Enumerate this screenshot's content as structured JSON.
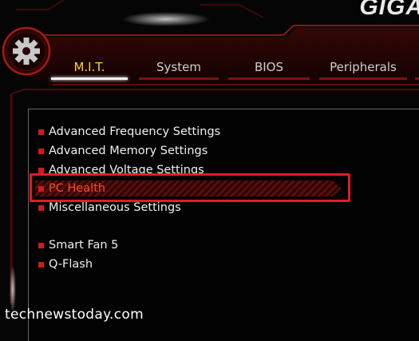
{
  "brand": {
    "name": "GIGA"
  },
  "tabs": [
    {
      "label": "M.I.T.",
      "active": true
    },
    {
      "label": "System",
      "active": false
    },
    {
      "label": "BIOS",
      "active": false
    },
    {
      "label": "Peripherals",
      "active": false
    },
    {
      "label": "",
      "active": false
    }
  ],
  "menu": {
    "items": [
      {
        "label": "Advanced Frequency Settings"
      },
      {
        "label": "Advanced Memory Settings"
      },
      {
        "label": "Advanced Voltage Settings"
      },
      {
        "label": "PC Health",
        "selected": true
      },
      {
        "label": "Miscellaneous Settings"
      },
      {
        "label": "Smart Fan 5"
      },
      {
        "label": "Q-Flash"
      }
    ]
  },
  "watermark": "technewstoday.com",
  "colors": {
    "accent_red": "#d11a1a",
    "highlight_box": "#e21c24",
    "active_tab_text": "#ffcf3a",
    "selected_text": "#ff4b24"
  },
  "icons": {
    "gear": "gear-icon"
  }
}
